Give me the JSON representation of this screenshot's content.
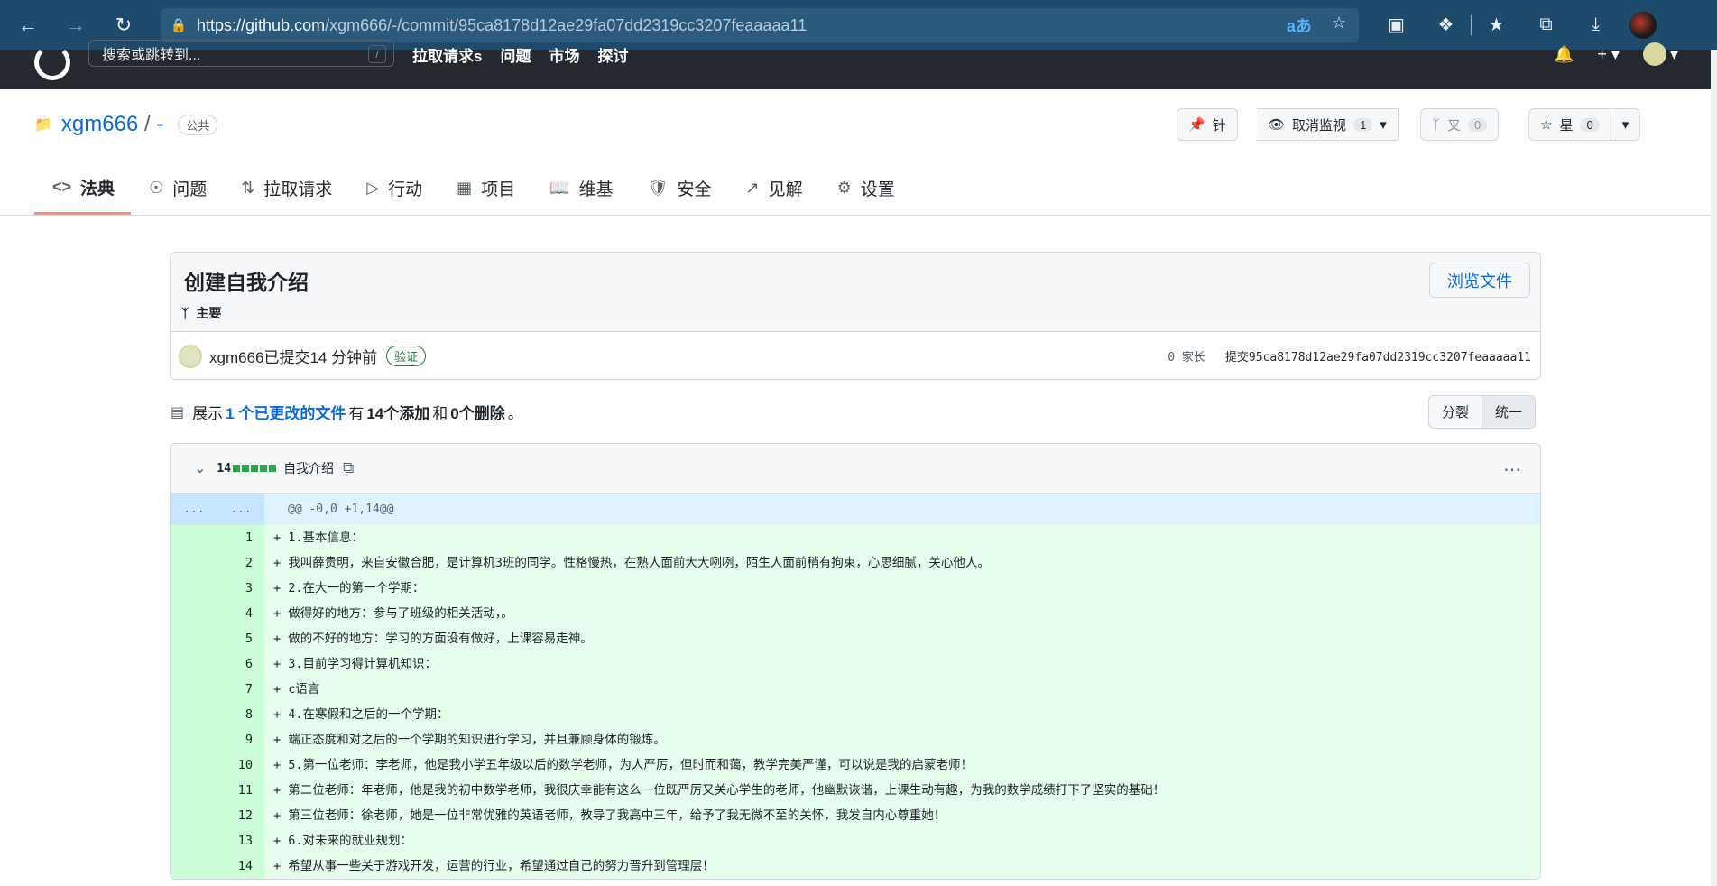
{
  "browser": {
    "url_host": "https://github.com",
    "url_path": "/xgm666/-/commit/95ca8178d12ae29fa07dd2319cc3207feaaaaa11"
  },
  "header": {
    "search_placeholder": "搜索或跳转到...",
    "search_shortcut": "/",
    "nav": [
      "拉取请求s",
      "问题",
      "市场",
      "探讨"
    ]
  },
  "repo": {
    "owner": "xgm666",
    "separator": "/",
    "name": "-",
    "visibility": "公共",
    "pin_label": "针",
    "watch_label": "取消监视",
    "watch_count": "1",
    "fork_label": "叉",
    "fork_count": "0",
    "star_label": "星",
    "star_count": "0"
  },
  "tabs": [
    {
      "label": "法典",
      "icon": "code-icon"
    },
    {
      "label": "问题",
      "icon": "issue-icon"
    },
    {
      "label": "拉取请求",
      "icon": "pull-request-icon"
    },
    {
      "label": "行动",
      "icon": "play-icon"
    },
    {
      "label": "项目",
      "icon": "table-icon"
    },
    {
      "label": "维基",
      "icon": "book-icon"
    },
    {
      "label": "安全",
      "icon": "shield-icon"
    },
    {
      "label": "见解",
      "icon": "graph-icon"
    },
    {
      "label": "设置",
      "icon": "gear-icon"
    }
  ],
  "commit": {
    "title": "创建自我介绍",
    "branch": "主要",
    "browse_files": "浏览文件",
    "author_line": "xgm666已提交14 分钟前",
    "verified": "验证",
    "parents": "0 家长",
    "sha_label": "提交95ca8178d12ae29fa07dd2319cc3207feaaaaa11"
  },
  "summary": {
    "prefix": "展示",
    "count": "1",
    "files_link": " 个已更改的文件",
    "with": "有",
    "additions": "14个添加",
    "and": "和",
    "deletions": "0个删除",
    "end": "。"
  },
  "view_toggle": {
    "split": "分裂",
    "unified": "统一"
  },
  "file": {
    "changes": "14",
    "name": "自我介绍",
    "hunk_left": "...",
    "hunk_right": "...",
    "hunk_header": "@@ -0,0 +1,14@@",
    "lines": [
      {
        "n": "1",
        "text": "+ 1.基本信息："
      },
      {
        "n": "2",
        "text": "+ 我叫薛贵明，来自安徽合肥，是计算机3班的同学。性格慢热，在熟人面前大大咧咧，陌生人面前稍有拘束，心思细腻，关心他人。"
      },
      {
        "n": "3",
        "text": "+ 2.在大一的第一个学期："
      },
      {
        "n": "4",
        "text": "+ 做得好的地方：参与了班级的相关活动，。"
      },
      {
        "n": "5",
        "text": "+ 做的不好的地方：学习的方面没有做好，上课容易走神。"
      },
      {
        "n": "6",
        "text": "+ 3.目前学习得计算机知识："
      },
      {
        "n": "7",
        "text": "+ c语言"
      },
      {
        "n": "8",
        "text": "+ 4.在寒假和之后的一个学期："
      },
      {
        "n": "9",
        "text": "+ 端正态度和对之后的一个学期的知识进行学习，并且兼顾身体的锻炼。"
      },
      {
        "n": "10",
        "text": "+ 5.第一位老师：李老师，他是我小学五年级以后的数学老师，为人严厉，但时而和蔼，教学完美严谨，可以说是我的启蒙老师！"
      },
      {
        "n": "11",
        "text": "+ 第二位老师：年老师，他是我的初中数学老师，我很庆幸能有这么一位既严厉又关心学生的老师，他幽默诙谐，上课生动有趣，为我的数学成绩打下了坚实的基础！"
      },
      {
        "n": "12",
        "text": "+ 第三位老师：徐老师，她是一位非常优雅的英语老师，教导了我高中三年，给予了我无微不至的关怀，我发自内心尊重她！"
      },
      {
        "n": "13",
        "text": "+ 6.对未来的就业规划："
      },
      {
        "n": "14",
        "text": "+ 希望从事一些关于游戏开发，运营的行业，希望通过自己的努力晋升到管理层！"
      }
    ]
  }
}
